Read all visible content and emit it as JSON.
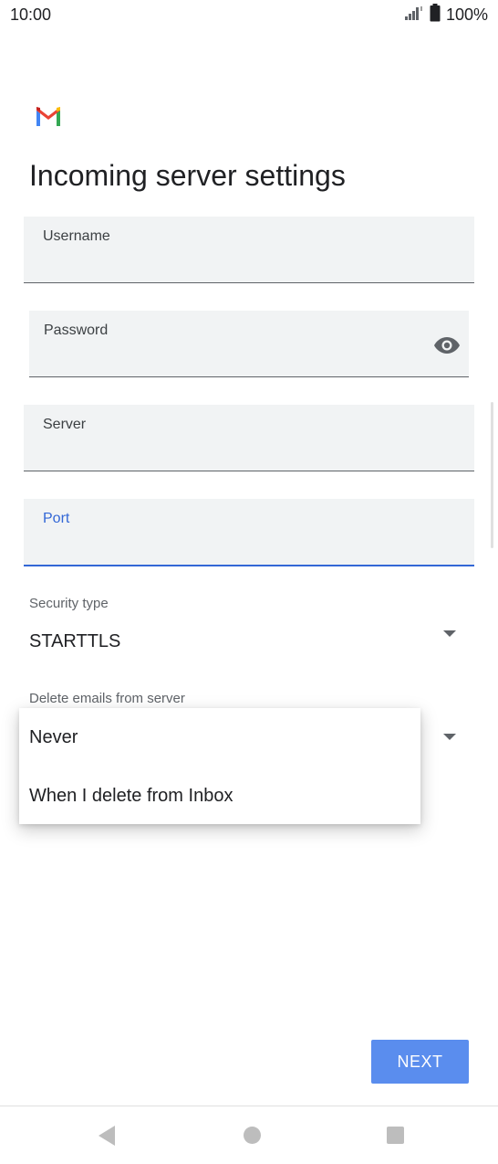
{
  "status_bar": {
    "time": "10:00",
    "battery": "100%"
  },
  "header": {
    "title": "Incoming server settings"
  },
  "fields": {
    "username": {
      "label": "Username"
    },
    "password": {
      "label": "Password"
    },
    "server": {
      "label": "Server"
    },
    "port": {
      "label": "Port"
    }
  },
  "security_type": {
    "label": "Security type",
    "value": "STARTTLS"
  },
  "delete_emails": {
    "label": "Delete emails from server"
  },
  "dropdown": {
    "options": [
      "Never",
      "When I delete from Inbox"
    ]
  },
  "next_button": {
    "label": "NEXT"
  },
  "colors": {
    "accent": "#3367d6",
    "button": "#5a8dee",
    "field_bg": "#f1f3f4"
  },
  "icons": [
    "signal-icon",
    "battery-icon",
    "gmail-logo",
    "eye-icon",
    "dropdown-arrow-icon",
    "back-icon",
    "home-icon",
    "recents-icon"
  ]
}
